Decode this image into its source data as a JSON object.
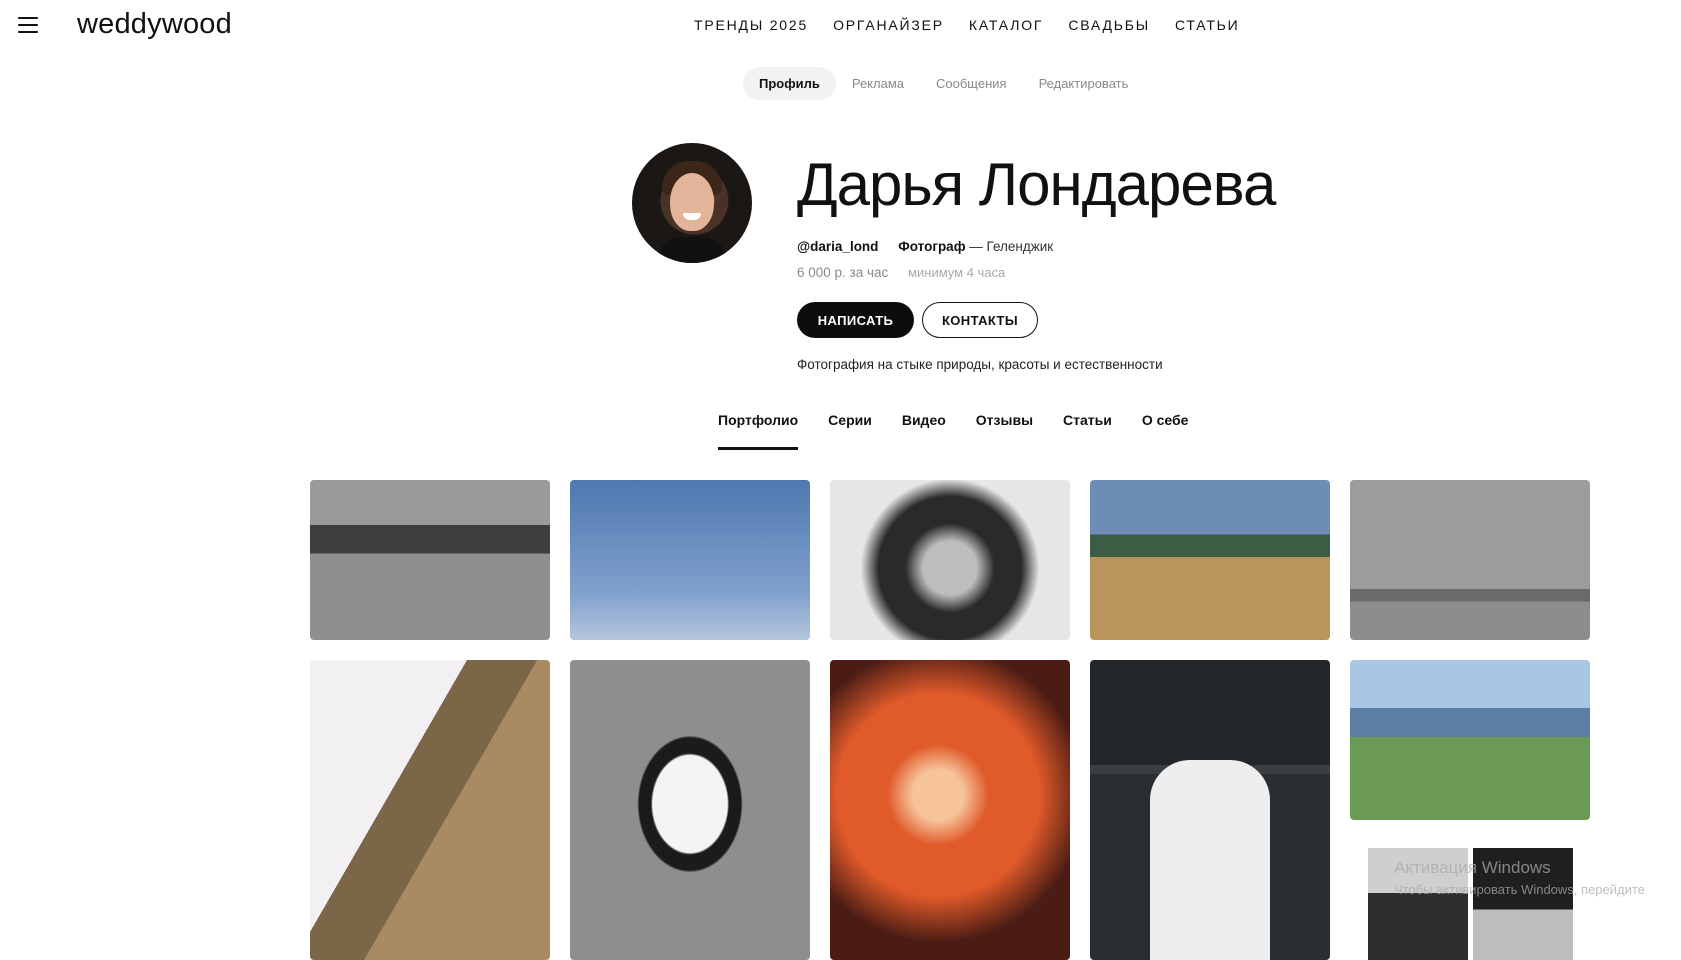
{
  "header": {
    "logo": "weddywood",
    "nav": [
      "ТРЕНДЫ 2025",
      "ОРГАНАЙЗЕР",
      "КАТАЛОГ",
      "СВАДЬБЫ",
      "СТАТЬИ"
    ]
  },
  "subnav": [
    "Профиль",
    "Реклама",
    "Сообщения",
    "Редактировать"
  ],
  "profile": {
    "name": "Дарья Лондарева",
    "handle": "@daria_lond",
    "role": "Фотограф",
    "city": "— Геленджик",
    "price": "6 000 р. за час",
    "minimum": "минимум 4 часа",
    "tagline": "Фотография на стыке природы, красоты и естественности"
  },
  "buttons": {
    "write": "НАПИСАТЬ",
    "contacts": "КОНТАКТЫ"
  },
  "tabs": [
    "Портфолио",
    "Серии",
    "Видео",
    "Отзывы",
    "Статьи",
    "О себе"
  ],
  "watermark": {
    "title": "Активация Windows",
    "subtitle": "Чтобы активировать Windows, перейдите"
  }
}
